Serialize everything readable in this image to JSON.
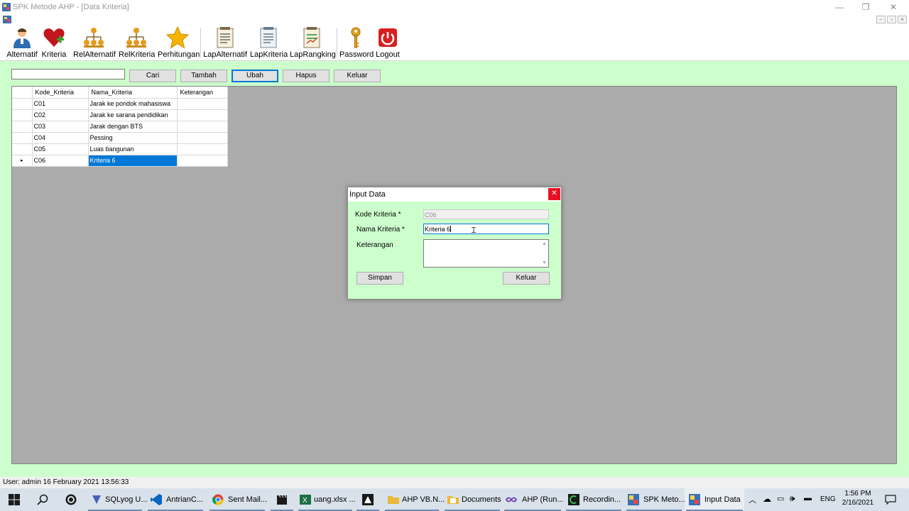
{
  "window": {
    "title": "SPK Metode AHP - [Data Kriteria]",
    "minimize_icon": "minimize-icon",
    "maximize_icon": "restore-icon",
    "close_icon": "close-icon"
  },
  "mdi": {
    "minimize": "–",
    "restore": "▫",
    "close": "×"
  },
  "toolbar": {
    "items": [
      {
        "label": "Alternatif",
        "icon": "person-icon"
      },
      {
        "label": "Kriteria",
        "icon": "heart-plus-icon"
      },
      {
        "label": "RelAlternatif",
        "icon": "hierarchy-icon"
      },
      {
        "label": "RelKriteria",
        "icon": "hierarchy-icon"
      },
      {
        "label": "Perhitungan",
        "icon": "star-icon"
      },
      {
        "label": "LapAlternatif",
        "icon": "report-icon"
      },
      {
        "label": "LapKriteria",
        "icon": "report-icon"
      },
      {
        "label": "LapRangking",
        "icon": "report-chart-icon"
      },
      {
        "label": "Password",
        "icon": "key-icon"
      },
      {
        "label": "Logout",
        "icon": "power-icon"
      }
    ]
  },
  "actions": {
    "search_value": "",
    "cari": "Cari",
    "tambah": "Tambah",
    "ubah": "Ubah",
    "hapus": "Hapus",
    "keluar": "Keluar"
  },
  "grid": {
    "columns": [
      "Kode_Kriteria",
      "Nama_Kriteria",
      "Keterangan"
    ],
    "rows": [
      {
        "kode": "C01",
        "nama": "Jarak ke pondok mahasiswa",
        "ket": ""
      },
      {
        "kode": "C02",
        "nama": "Jarak ke sarana pendidikan",
        "ket": ""
      },
      {
        "kode": "C03",
        "nama": "Jarak dengan BTS",
        "ket": ""
      },
      {
        "kode": "C04",
        "nama": "Pessing",
        "ket": ""
      },
      {
        "kode": "C05",
        "nama": "Luas bangunan",
        "ket": ""
      },
      {
        "kode": "C06",
        "nama": "Kriteria 6",
        "ket": ""
      }
    ],
    "current_row_marker": "▸"
  },
  "dialog": {
    "title": "Input Data",
    "close": "✕",
    "kode_label": "Kode Kriteria *",
    "kode_value": "C06",
    "nama_label": "Nama Kriteria *",
    "nama_value": "Kriteria 6",
    "ket_label": "Keterangan",
    "ket_value": "",
    "simpan": "Simpan",
    "keluar": "Keluar"
  },
  "status": {
    "text": "User: admin  16 February 2021 13:56:33"
  },
  "taskbar": {
    "items": [
      {
        "label": "",
        "icon": "windows-start-icon"
      },
      {
        "label": "",
        "icon": "search-icon"
      },
      {
        "label": "",
        "icon": "whatsapp-icon"
      },
      {
        "label": "SQLyog U...",
        "icon": "sqlyog-icon"
      },
      {
        "label": "AntrianC...",
        "icon": "vscode-icon"
      },
      {
        "label": "Sent Mail...",
        "icon": "chrome-icon"
      },
      {
        "label": "",
        "icon": "clapper-icon"
      },
      {
        "label": "uang.xlsx ...",
        "icon": "excel-icon"
      },
      {
        "label": "",
        "icon": "inkscape-icon"
      },
      {
        "label": "AHP VB.N...",
        "icon": "folder-icon"
      },
      {
        "label": "Documents",
        "icon": "documents-icon"
      },
      {
        "label": "AHP (Run...",
        "icon": "visualstudio-icon"
      },
      {
        "label": "Recordin...",
        "icon": "camtasia-icon"
      },
      {
        "label": "SPK Meto...",
        "icon": "app-icon"
      },
      {
        "label": "Input Data",
        "icon": "app-icon"
      }
    ],
    "lang": "ENG",
    "time": "1:56 PM",
    "date": "2/16/2021"
  }
}
